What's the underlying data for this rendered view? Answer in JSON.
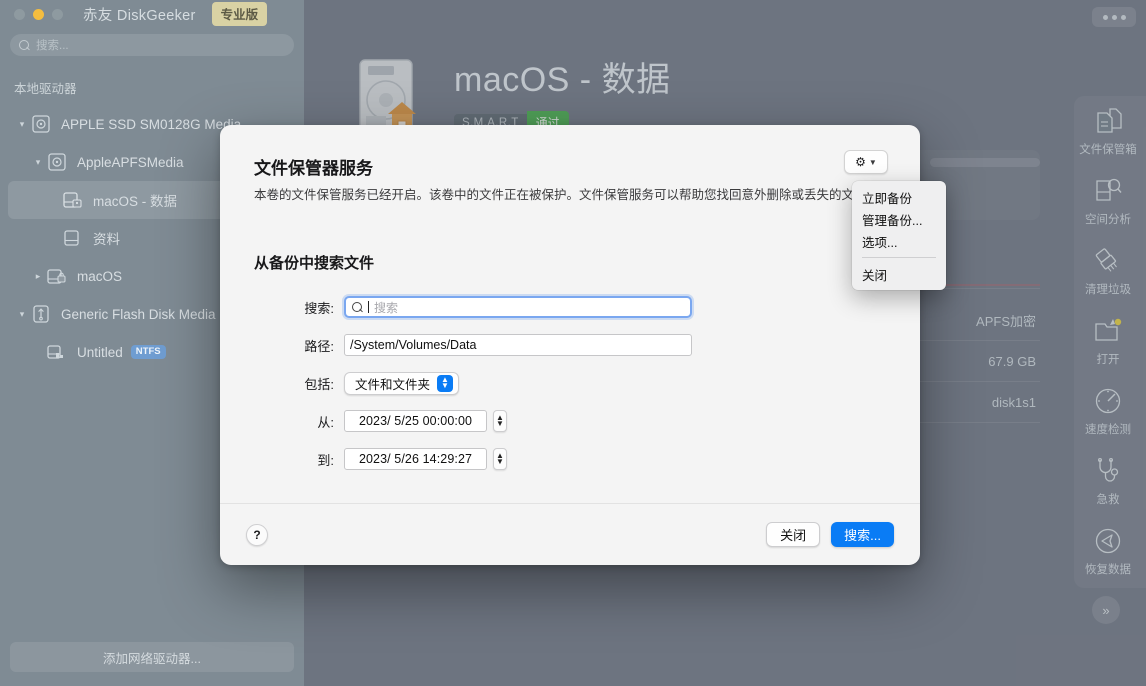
{
  "window": {
    "app_title": "赤友 DiskGeeker",
    "pro_badge": "专业版",
    "menu_icon": "ellipsis-icon"
  },
  "sidebar": {
    "search_placeholder": "搜索...",
    "section_label": "本地驱动器",
    "tree": [
      {
        "label": "APPLE SSD SM0128G Media",
        "indent": 0,
        "twisty": "▾",
        "icon": "disk-icon",
        "selected": false,
        "badge": ""
      },
      {
        "label": "AppleAPFSMedia",
        "indent": 1,
        "twisty": "▾",
        "icon": "disk-icon",
        "selected": false,
        "badge": ""
      },
      {
        "label": "macOS - 数据",
        "indent": 2,
        "twisty": "",
        "icon": "volume-data-icon",
        "selected": true,
        "badge": ""
      },
      {
        "label": "资料",
        "indent": 2,
        "twisty": "",
        "icon": "volume-icon",
        "selected": false,
        "badge": ""
      },
      {
        "label": "macOS",
        "indent": 2,
        "twisty": "▸",
        "icon": "volume-locked-icon",
        "selected": false,
        "badge": ""
      },
      {
        "label": "Generic Flash Disk Media",
        "indent": 0,
        "twisty": "▾",
        "icon": "usb-icon",
        "selected": false,
        "badge": ""
      },
      {
        "label": "Untitled",
        "indent": 1,
        "twisty": "",
        "icon": "volume-icon",
        "selected": false,
        "badge": "NTFS"
      }
    ],
    "add_network_drive": "添加网络驱动器..."
  },
  "main": {
    "volume_title": "macOS - 数据",
    "smart_label": "S.M.A.R.T",
    "smart_value": "通过",
    "info_rows": [
      {
        "value": "APFS加密"
      },
      {
        "value": "67.9 GB"
      },
      {
        "value": "disk1s1"
      }
    ]
  },
  "rail": {
    "items": [
      {
        "label": "文件保管箱",
        "icon": "file-vault-icon"
      },
      {
        "label": "空间分析",
        "icon": "space-analysis-icon"
      },
      {
        "label": "清理垃圾",
        "icon": "clean-junk-icon"
      },
      {
        "label": "打开",
        "icon": "open-folder-icon"
      },
      {
        "label": "速度检测",
        "icon": "speed-test-icon"
      },
      {
        "label": "急救",
        "icon": "first-aid-icon"
      },
      {
        "label": "恢复数据",
        "icon": "recover-data-icon"
      }
    ],
    "more_label": "»"
  },
  "dialog": {
    "title": "文件保管器服务",
    "description": "本卷的文件保管服务已经开启。该卷中的文件正在被保护。文件保管服务可以帮助您找回意外删除或丢失的文件。",
    "gear_icon": "gear-icon",
    "chevron_icon": "chevron-down-icon",
    "menu": {
      "items": [
        "立即备份",
        "管理备份...",
        "选项..."
      ],
      "close_item": "关闭"
    },
    "section_title": "从备份中搜索文件",
    "fields": {
      "search_label": "搜索:",
      "search_value": "",
      "search_placeholder": "搜索",
      "search_icon": "search-icon",
      "path_label": "路径:",
      "path_value": "/System/Volumes/Data",
      "include_label": "包括:",
      "include_value": "文件和文件夹",
      "from_label": "从:",
      "from_value": "2023/  5/25 00:00:00",
      "to_label": "到:",
      "to_value": "2023/  5/26 14:29:27"
    },
    "footer": {
      "help": "?",
      "close_button": "关闭",
      "search_button": "搜索..."
    }
  },
  "colors": {
    "accent_blue": "#0a7cf5",
    "focus_ring": "#7aa7f0",
    "smart_green": "#57b45e",
    "badge_gold": "#d9d2a4",
    "ntfs_blue": "#6f9dd1",
    "sidebar": "#7f8b94",
    "content_bg": "#7b828e"
  }
}
